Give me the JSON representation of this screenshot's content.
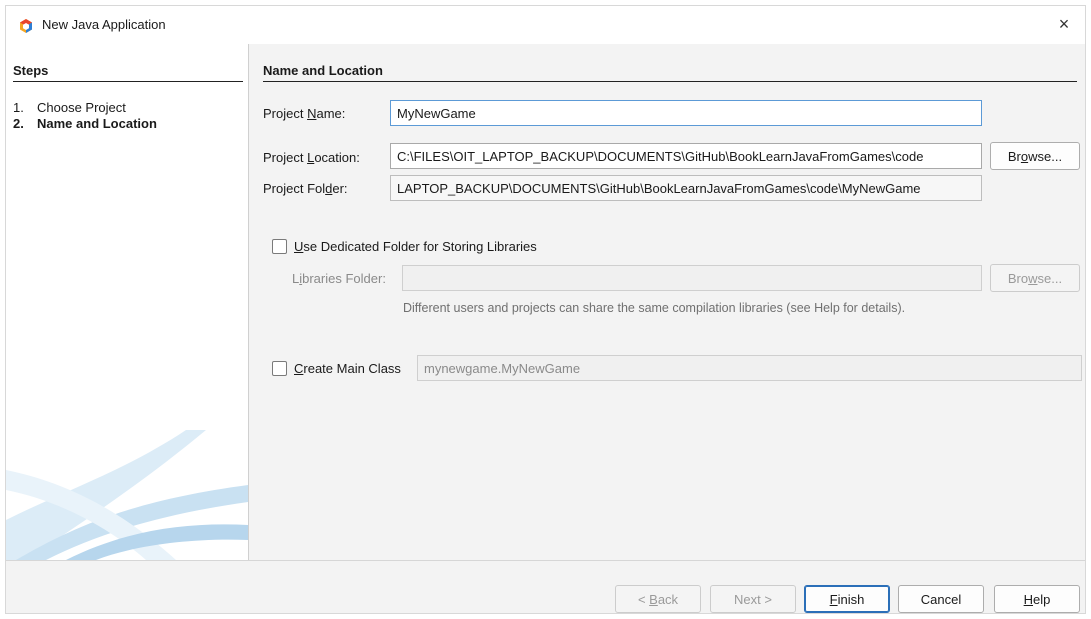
{
  "window": {
    "title": "New Java Application",
    "close_glyph": "×",
    "app_icon": "netbeans-logo"
  },
  "steps": {
    "title": "Steps",
    "items": [
      {
        "num": "1.",
        "label": "Choose Project",
        "current": false
      },
      {
        "num": "2.",
        "label": "Name and Location",
        "current": true
      }
    ]
  },
  "main": {
    "title": "Name and Location",
    "project_name": {
      "label_pre": "Project ",
      "label_key": "N",
      "label_post": "ame:",
      "value": "MyNewGame"
    },
    "project_location": {
      "label_pre": "Project ",
      "label_key": "L",
      "label_post": "ocation:",
      "value": "C:\\FILES\\OIT_LAPTOP_BACKUP\\DOCUMENTS\\GitHub\\BookLearnJavaFromGames\\code",
      "browse_pre": "Br",
      "browse_key": "o",
      "browse_post": "wse..."
    },
    "project_folder": {
      "label_pre": "Project Fol",
      "label_key": "d",
      "label_post": "er:",
      "value": "LAPTOP_BACKUP\\DOCUMENTS\\GitHub\\BookLearnJavaFromGames\\code\\MyNewGame"
    },
    "dedicated_folder": {
      "label_key": "U",
      "label_post": "se Dedicated Folder for Storing Libraries",
      "checked": false
    },
    "libraries_folder": {
      "label_pre": "L",
      "label_key": "i",
      "label_post": "braries Folder:",
      "value": "",
      "browse_pre": "Bro",
      "browse_key": "w",
      "browse_post": "se..."
    },
    "hint": "Different users and projects can share the same compilation libraries (see Help for details).",
    "create_main_class": {
      "label_key": "C",
      "label_post": "reate Main Class",
      "checked": false,
      "value": "mynewgame.MyNewGame"
    }
  },
  "buttons": {
    "back": {
      "pre": "< ",
      "key": "B",
      "post": "ack"
    },
    "next": "Next >",
    "finish": {
      "key": "F",
      "post": "inish"
    },
    "cancel": "Cancel",
    "help": {
      "key": "H",
      "post": "elp"
    }
  },
  "colors": {
    "accent": "#2b6fb8",
    "focus_border": "#5c9ad6",
    "window_bg": "#f3f3f3",
    "disabled_text": "#8a8a8a"
  }
}
